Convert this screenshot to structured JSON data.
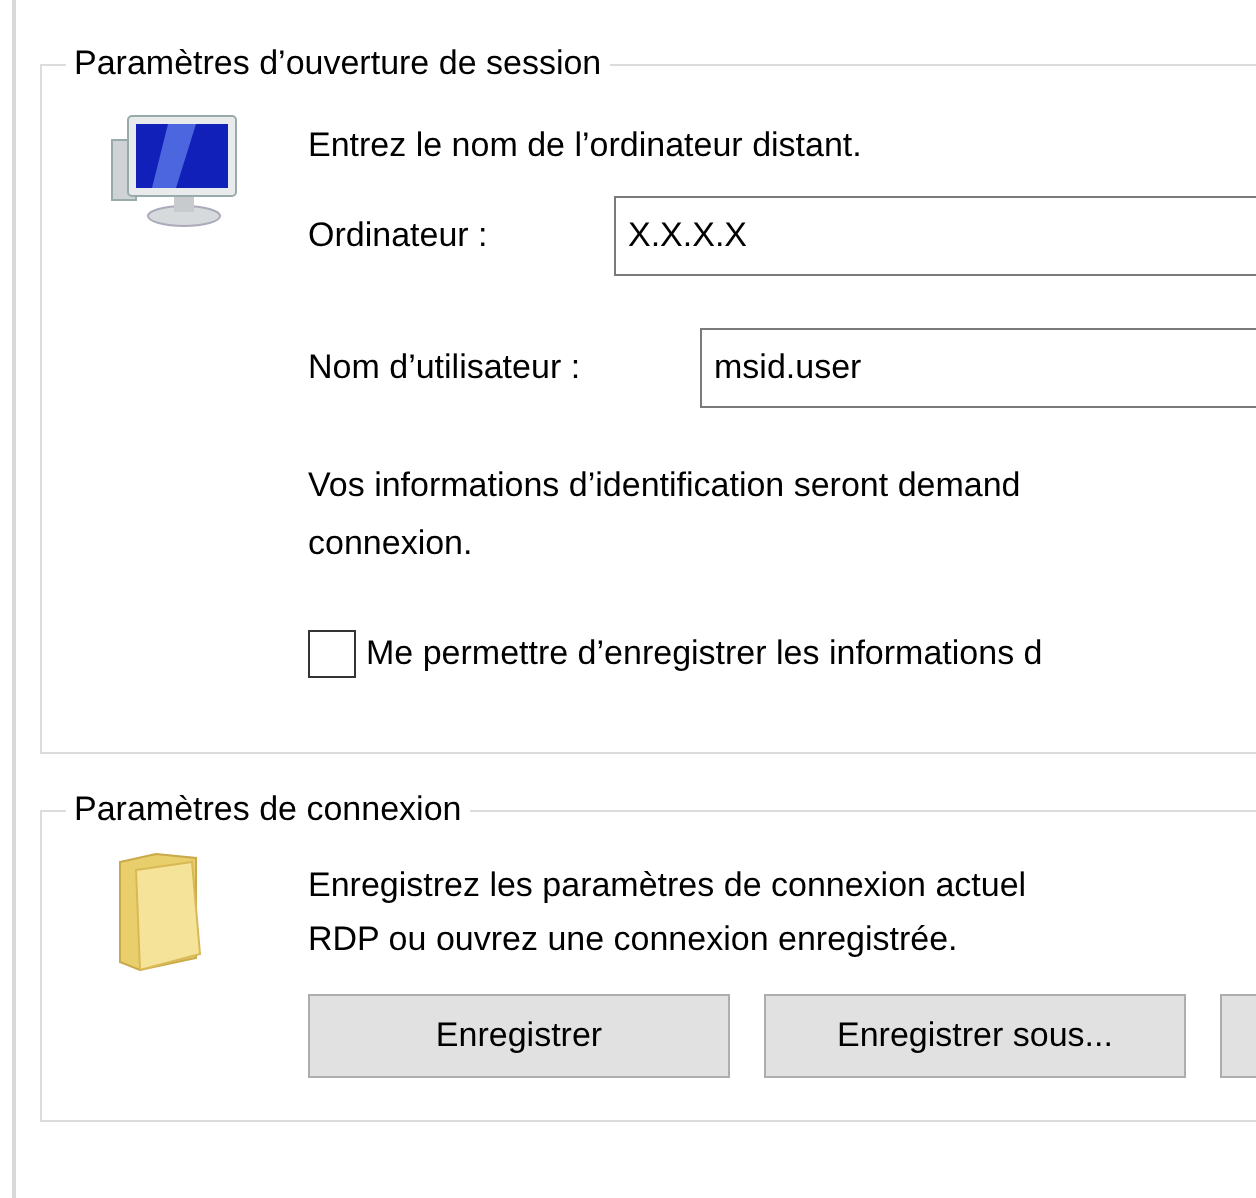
{
  "logon_settings": {
    "title": "Paramètres d’ouverture de session",
    "instruction": "Entrez le nom de l’ordinateur distant.",
    "fields": [
      {
        "label": "Ordinateur :",
        "value": "X.X.X.X"
      },
      {
        "label": "Nom d’utilisateur :",
        "value": "msid.user"
      }
    ],
    "note": [
      "Vos informations d’identification seront demand",
      "connexion."
    ],
    "save_credentials": {
      "label": "Me permettre d’enregistrer les informations d",
      "checked": false
    }
  },
  "connection_settings": {
    "title": "Paramètres de connexion",
    "description": [
      "Enregistrez les paramètres de connexion actuel",
      "RDP ou ouvrez une connexion enregistrée."
    ],
    "buttons": [
      {
        "kind": "labeled",
        "label": "Enregistrer"
      },
      {
        "kind": "labeled",
        "label": "Enregistrer sous..."
      },
      {
        "kind": "cut"
      }
    ]
  }
}
